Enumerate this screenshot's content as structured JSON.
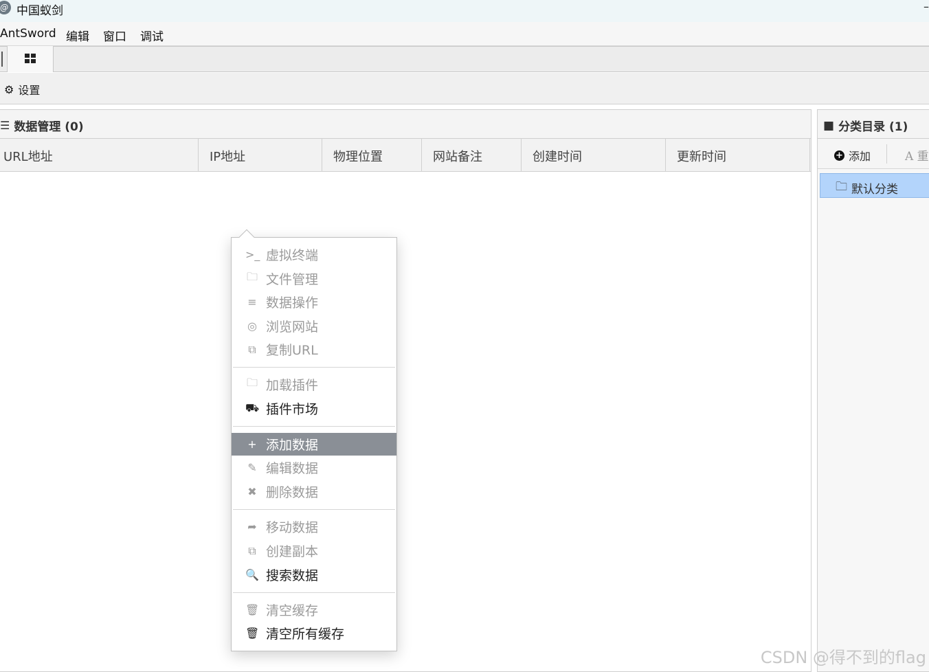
{
  "window": {
    "title": "中国蚁剑",
    "logo_glyph": "@",
    "minimize_glyph": "–"
  },
  "menubar": {
    "items": [
      "AntSword",
      "编辑",
      "窗口",
      "调试"
    ]
  },
  "toolbar": {
    "settings_label": "设置"
  },
  "data_panel": {
    "title": "数据管理 (0)",
    "columns": [
      "URL地址",
      "IP地址",
      "物理位置",
      "网站备注",
      "创建时间",
      "更新时间"
    ]
  },
  "category_panel": {
    "title": "分类目录 (1)",
    "add_label": "添加",
    "rename_label": "A 重",
    "items": [
      "默认分类"
    ]
  },
  "context_menu": {
    "items": [
      {
        "label": "虚拟终端",
        "icon": "terminal-icon",
        "glyph": ">_",
        "enabled": false
      },
      {
        "label": "文件管理",
        "icon": "folder-icon",
        "glyph": "🗀",
        "enabled": false
      },
      {
        "label": "数据操作",
        "icon": "database-icon",
        "glyph": "≡",
        "enabled": false
      },
      {
        "label": "浏览网站",
        "icon": "chrome-icon",
        "glyph": "◎",
        "enabled": false
      },
      {
        "label": "复制URL",
        "icon": "copy-icon",
        "glyph": "⧉",
        "enabled": false
      },
      {
        "label": "加载插件",
        "icon": "folder-icon",
        "glyph": "🗀",
        "enabled": false
      },
      {
        "label": "插件市场",
        "icon": "cart-icon",
        "glyph": "⛟",
        "enabled": true
      },
      {
        "label": "添加数据",
        "icon": "plus-circle-icon",
        "glyph": "+",
        "enabled": true,
        "active": true
      },
      {
        "label": "编辑数据",
        "icon": "edit-icon",
        "glyph": "✎",
        "enabled": false
      },
      {
        "label": "删除数据",
        "icon": "close-icon",
        "glyph": "✖",
        "enabled": false
      },
      {
        "label": "移动数据",
        "icon": "share-icon",
        "glyph": "➦",
        "enabled": false
      },
      {
        "label": "创建副本",
        "icon": "copy-icon",
        "glyph": "⧉",
        "enabled": false
      },
      {
        "label": "搜索数据",
        "icon": "search-icon",
        "glyph": "🔍",
        "enabled": true
      },
      {
        "label": "清空缓存",
        "icon": "trash-icon",
        "glyph": "🗑",
        "enabled": false
      },
      {
        "label": "清空所有缓存",
        "icon": "trash-icon",
        "glyph": "🗑",
        "enabled": true
      }
    ]
  },
  "watermark": "CSDN @得不到的flag"
}
